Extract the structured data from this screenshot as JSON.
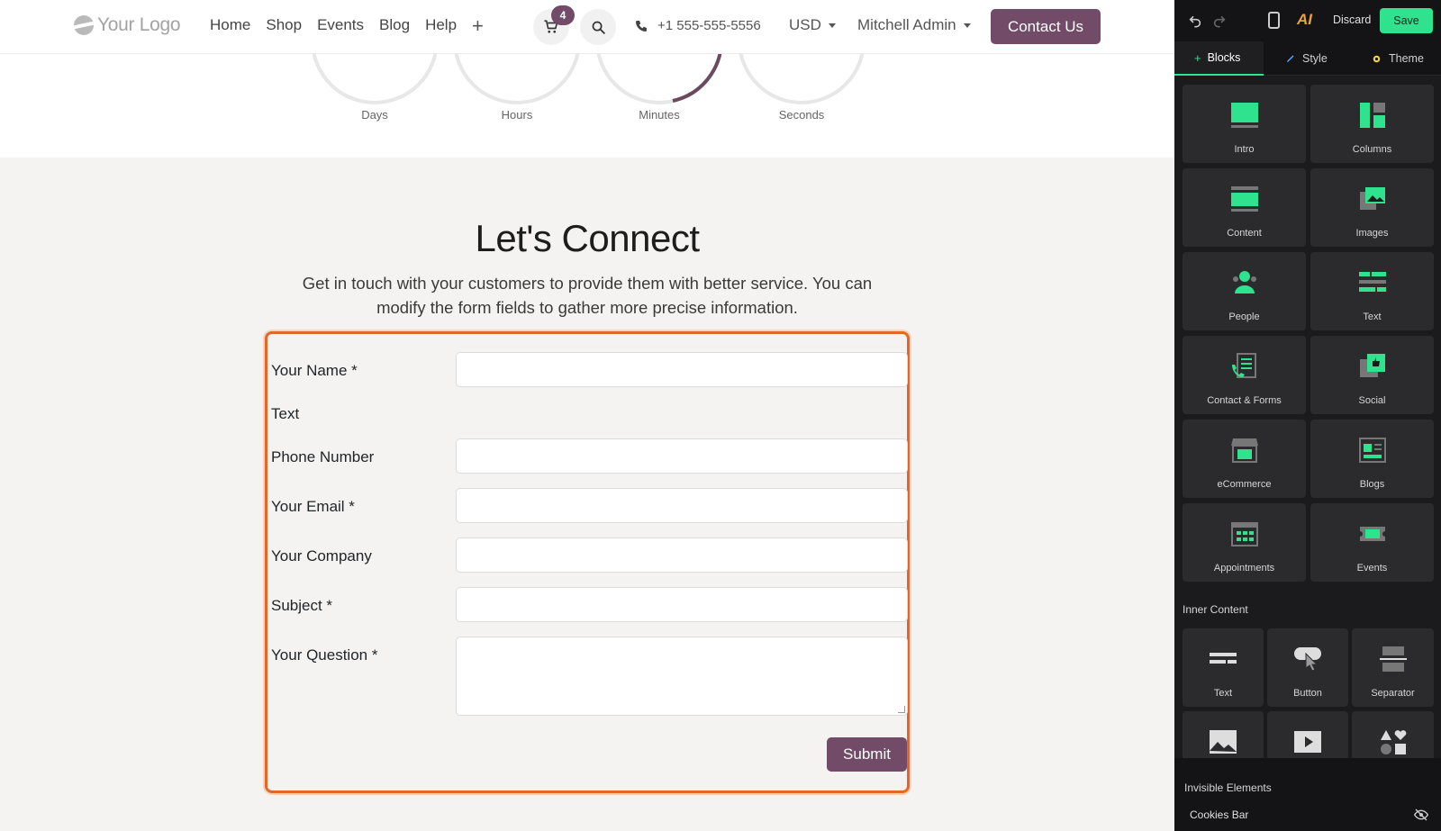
{
  "navbar": {
    "logo_text": "Your Logo",
    "links": [
      "Home",
      "Shop",
      "Events",
      "Blog",
      "Help"
    ],
    "add_icon": "plus-icon",
    "cart_count": "4",
    "phone": "+1 555-555-5556",
    "currency": "USD",
    "user": "Mitchell Admin",
    "contact_button": "Contact Us"
  },
  "countdown": {
    "labels": [
      "Days",
      "Hours",
      "Minutes",
      "Seconds"
    ]
  },
  "connect": {
    "title": "Let's Connect",
    "description": "Get in touch with your customers to provide them with better service. You can modify the form fields to gather more precise information.",
    "fields": [
      {
        "label": "Your Name *",
        "value": ""
      },
      {
        "label": "Text"
      },
      {
        "label": "Phone Number",
        "value": ""
      },
      {
        "label": "Your Email *",
        "value": ""
      },
      {
        "label": "Your Company",
        "value": ""
      },
      {
        "label": "Subject *",
        "value": ""
      },
      {
        "label": "Your Question *",
        "value": ""
      }
    ],
    "submit": "Submit"
  },
  "panel": {
    "discard": "Discard",
    "save": "Save",
    "ai_label": "AI",
    "tabs": [
      "Blocks",
      "Style",
      "Theme"
    ],
    "blocks": [
      "Intro",
      "Columns",
      "Content",
      "Images",
      "People",
      "Text",
      "Contact & Forms",
      "Social",
      "eCommerce",
      "Blogs",
      "Appointments",
      "Events"
    ],
    "inner_content_title": "Inner Content",
    "inner_blocks": [
      "Text",
      "Button",
      "Separator"
    ],
    "invisible_title": "Invisible Elements",
    "invisible_items": [
      "Cookies Bar"
    ]
  },
  "colors": {
    "brand": "#714b67",
    "accent_green": "#2ee28e",
    "form_highlight": "#e2682a"
  }
}
